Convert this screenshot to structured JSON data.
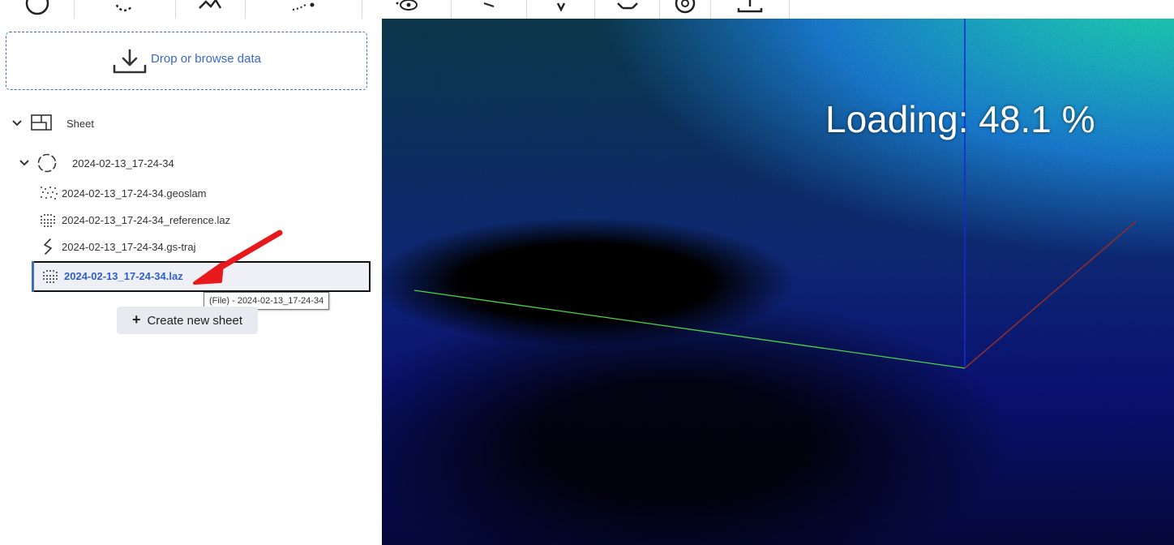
{
  "toolbar": {
    "buttons": [
      {
        "name": "compass-icon"
      },
      {
        "name": "rotate-icon"
      },
      {
        "name": "hand-icon"
      },
      {
        "name": "trajectory-icon"
      },
      {
        "name": "eye-icon"
      },
      {
        "name": "pointer-icon"
      },
      {
        "name": "arrow-down-icon"
      },
      {
        "name": "move-icon"
      },
      {
        "name": "target-icon"
      },
      {
        "name": "export-icon"
      }
    ]
  },
  "sidebar": {
    "drop_label": "Drop or browse data",
    "tree": {
      "sheet_label": "Sheet",
      "group_label": "2024-02-13_17-24-34",
      "files": [
        {
          "label": "2024-02-13_17-24-34.geoslam",
          "icon": "scatter-icon"
        },
        {
          "label": "2024-02-13_17-24-34_reference.laz",
          "icon": "point-grid-icon"
        },
        {
          "label": "2024-02-13_17-24-34.gs-traj",
          "icon": "trajectory-line-icon"
        },
        {
          "label": "2024-02-13_17-24-34.laz",
          "icon": "point-grid-icon",
          "selected": true
        }
      ]
    },
    "tooltip": "(File) - 2024-02-13_17-24-34",
    "create_button": "Create new sheet",
    "colors": {
      "accent": "#3668c9",
      "selected_text": "#2f5fd0",
      "annotation_arrow": "#e8191c"
    }
  },
  "viewer": {
    "loading_text": "Loading: 48.1 %"
  }
}
